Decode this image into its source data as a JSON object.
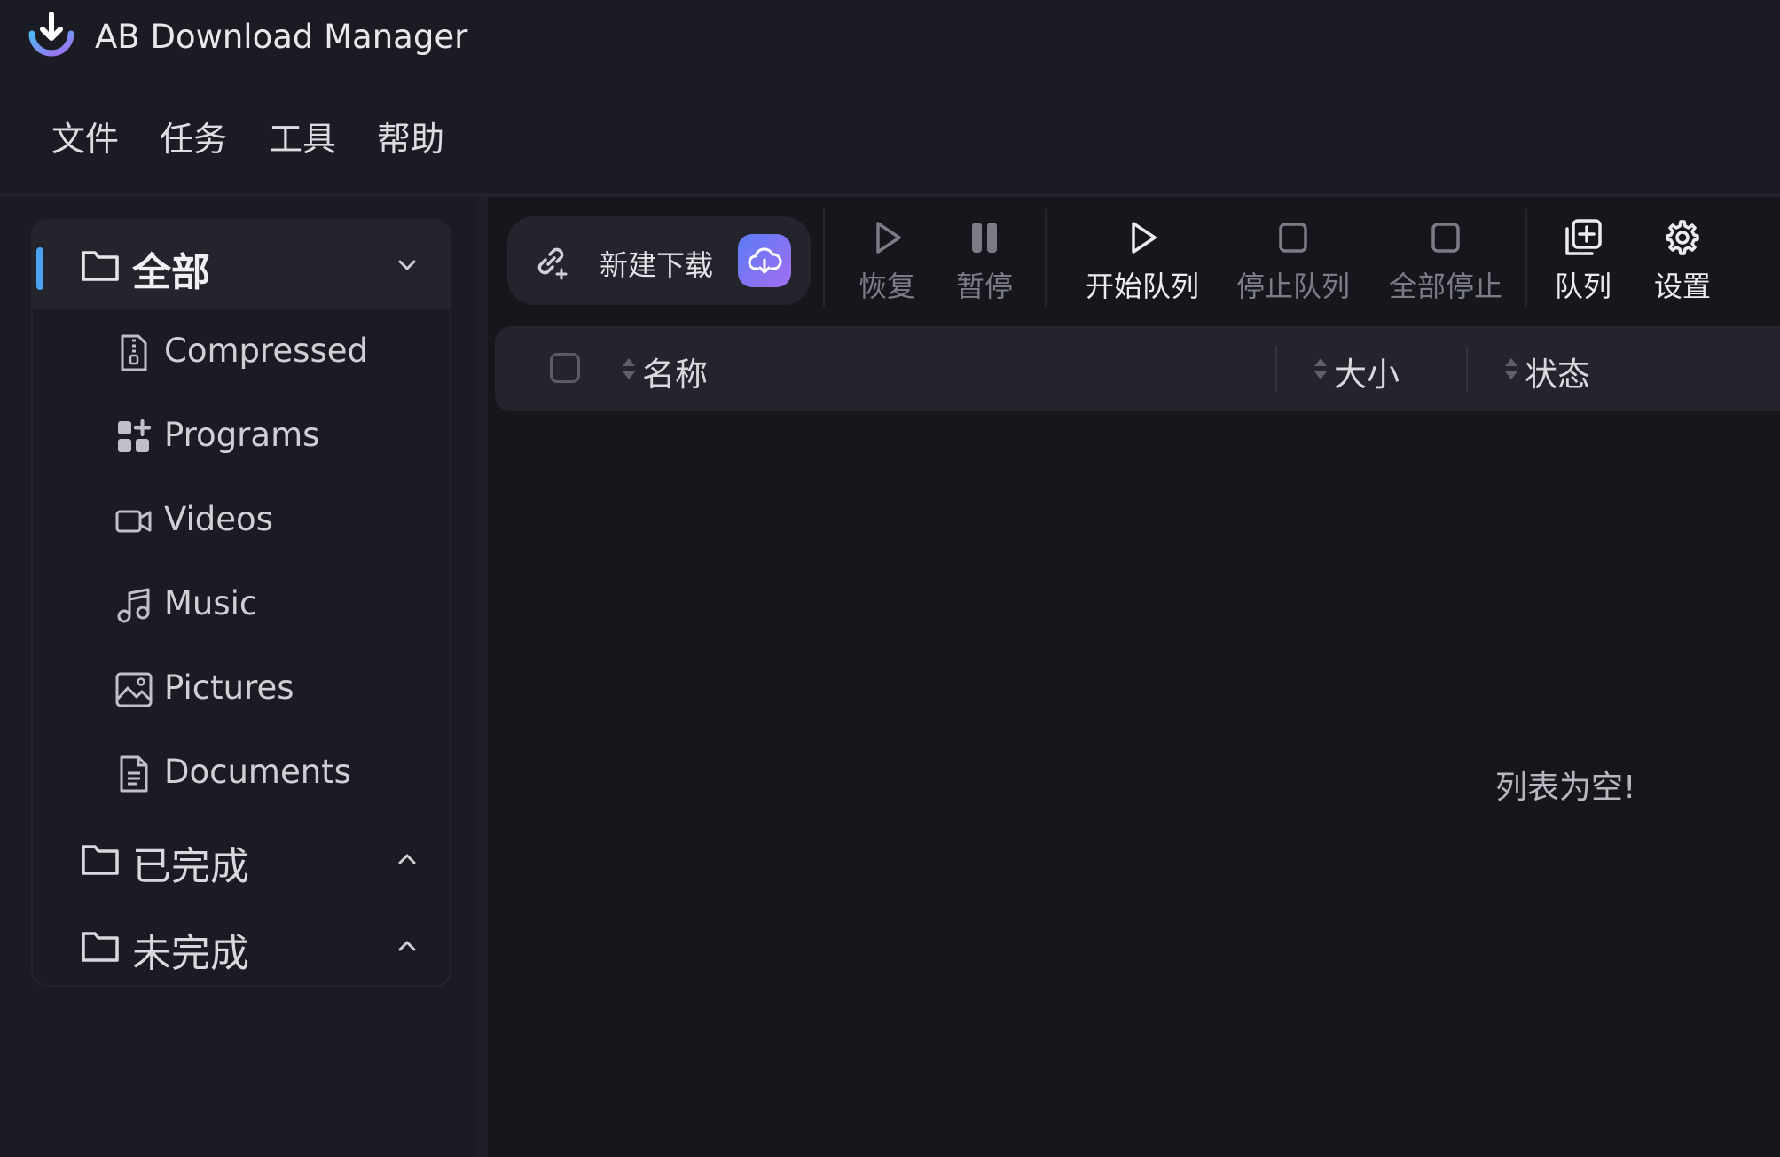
{
  "app": {
    "title": "AB Download Manager",
    "logo_icon": "download-logo-icon"
  },
  "menu": [
    "文件",
    "任务",
    "工具",
    "帮助"
  ],
  "sidebar": {
    "all": {
      "label": "全部",
      "expanded": true
    },
    "items": [
      {
        "label": "Compressed",
        "icon": "zip-file-icon"
      },
      {
        "label": "Programs",
        "icon": "apps-icon"
      },
      {
        "label": "Videos",
        "icon": "video-camera-icon"
      },
      {
        "label": "Music",
        "icon": "music-note-icon"
      },
      {
        "label": "Pictures",
        "icon": "image-icon"
      },
      {
        "label": "Documents",
        "icon": "document-icon"
      }
    ],
    "finished": {
      "label": "已完成",
      "expanded": false
    },
    "unfinished": {
      "label": "未完成",
      "expanded": false
    }
  },
  "toolbar": {
    "new_download": "新建下载",
    "resume": "恢复",
    "pause": "暂停",
    "start_queue": "开始队列",
    "stop_queue": "停止队列",
    "stop_all": "全部停止",
    "queue": "队列",
    "settings": "设置"
  },
  "table": {
    "columns": [
      "名称",
      "大小",
      "状态"
    ],
    "empty_message": "列表为空!"
  },
  "colors": {
    "background": "#16171d",
    "panel": "#1b1c23",
    "accent": "#4aa3f0",
    "cloud_gradient": [
      "#5a7cf5",
      "#a46df1"
    ]
  }
}
